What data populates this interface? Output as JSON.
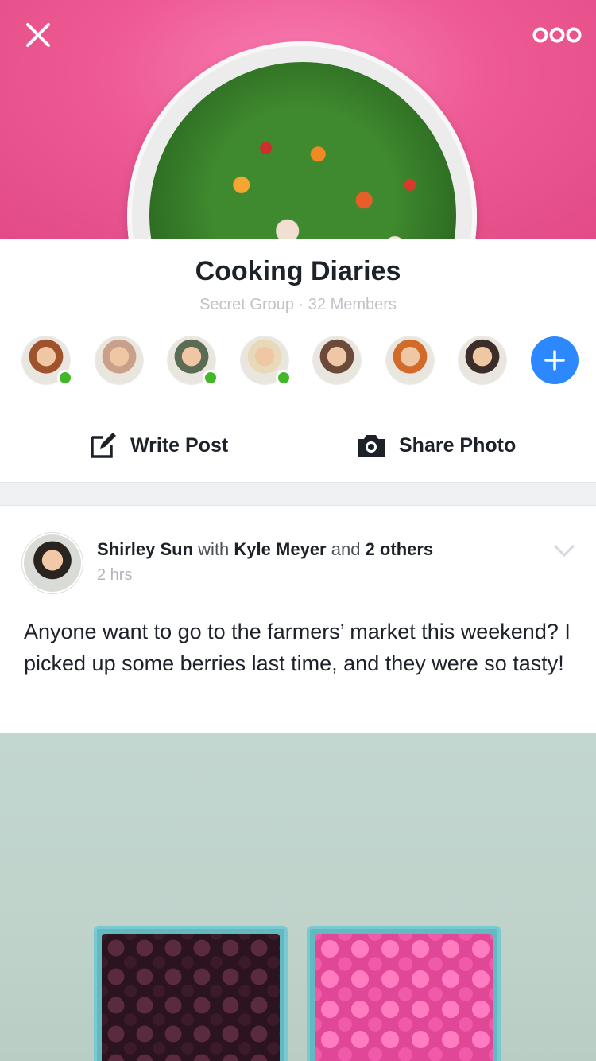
{
  "cover": {
    "close_icon": "close-icon",
    "more_icon": "more-options-icon",
    "accent": "#ee5a95"
  },
  "group": {
    "title": "Cooking Diaries",
    "subtitle": "Secret Group · 32 Members"
  },
  "members": [
    {
      "name": "member-1",
      "online": true,
      "color": "#a0522d"
    },
    {
      "name": "member-2",
      "online": false,
      "color": "#c9a08a"
    },
    {
      "name": "member-3",
      "online": true,
      "color": "#5b6b54"
    },
    {
      "name": "member-4",
      "online": true,
      "color": "#e8d9b8"
    },
    {
      "name": "member-5",
      "online": false,
      "color": "#6b4a3a"
    },
    {
      "name": "member-6",
      "online": false,
      "color": "#d26a2a"
    },
    {
      "name": "member-7",
      "online": false,
      "color": "#3a2d2a"
    }
  ],
  "actions": {
    "write_post": "Write Post",
    "share_photo": "Share Photo"
  },
  "post": {
    "author": "Shirley Sun",
    "with_word": "with",
    "tagged": "Kyle Meyer",
    "and_word": "and",
    "others": "2 others",
    "time": "2 hrs",
    "text": "Anyone want to go to the farmers’ market this weekend? I picked up some berries last time, and they were so tasty!"
  },
  "colors": {
    "online": "#42b72a",
    "add_button": "#2d88ff"
  }
}
